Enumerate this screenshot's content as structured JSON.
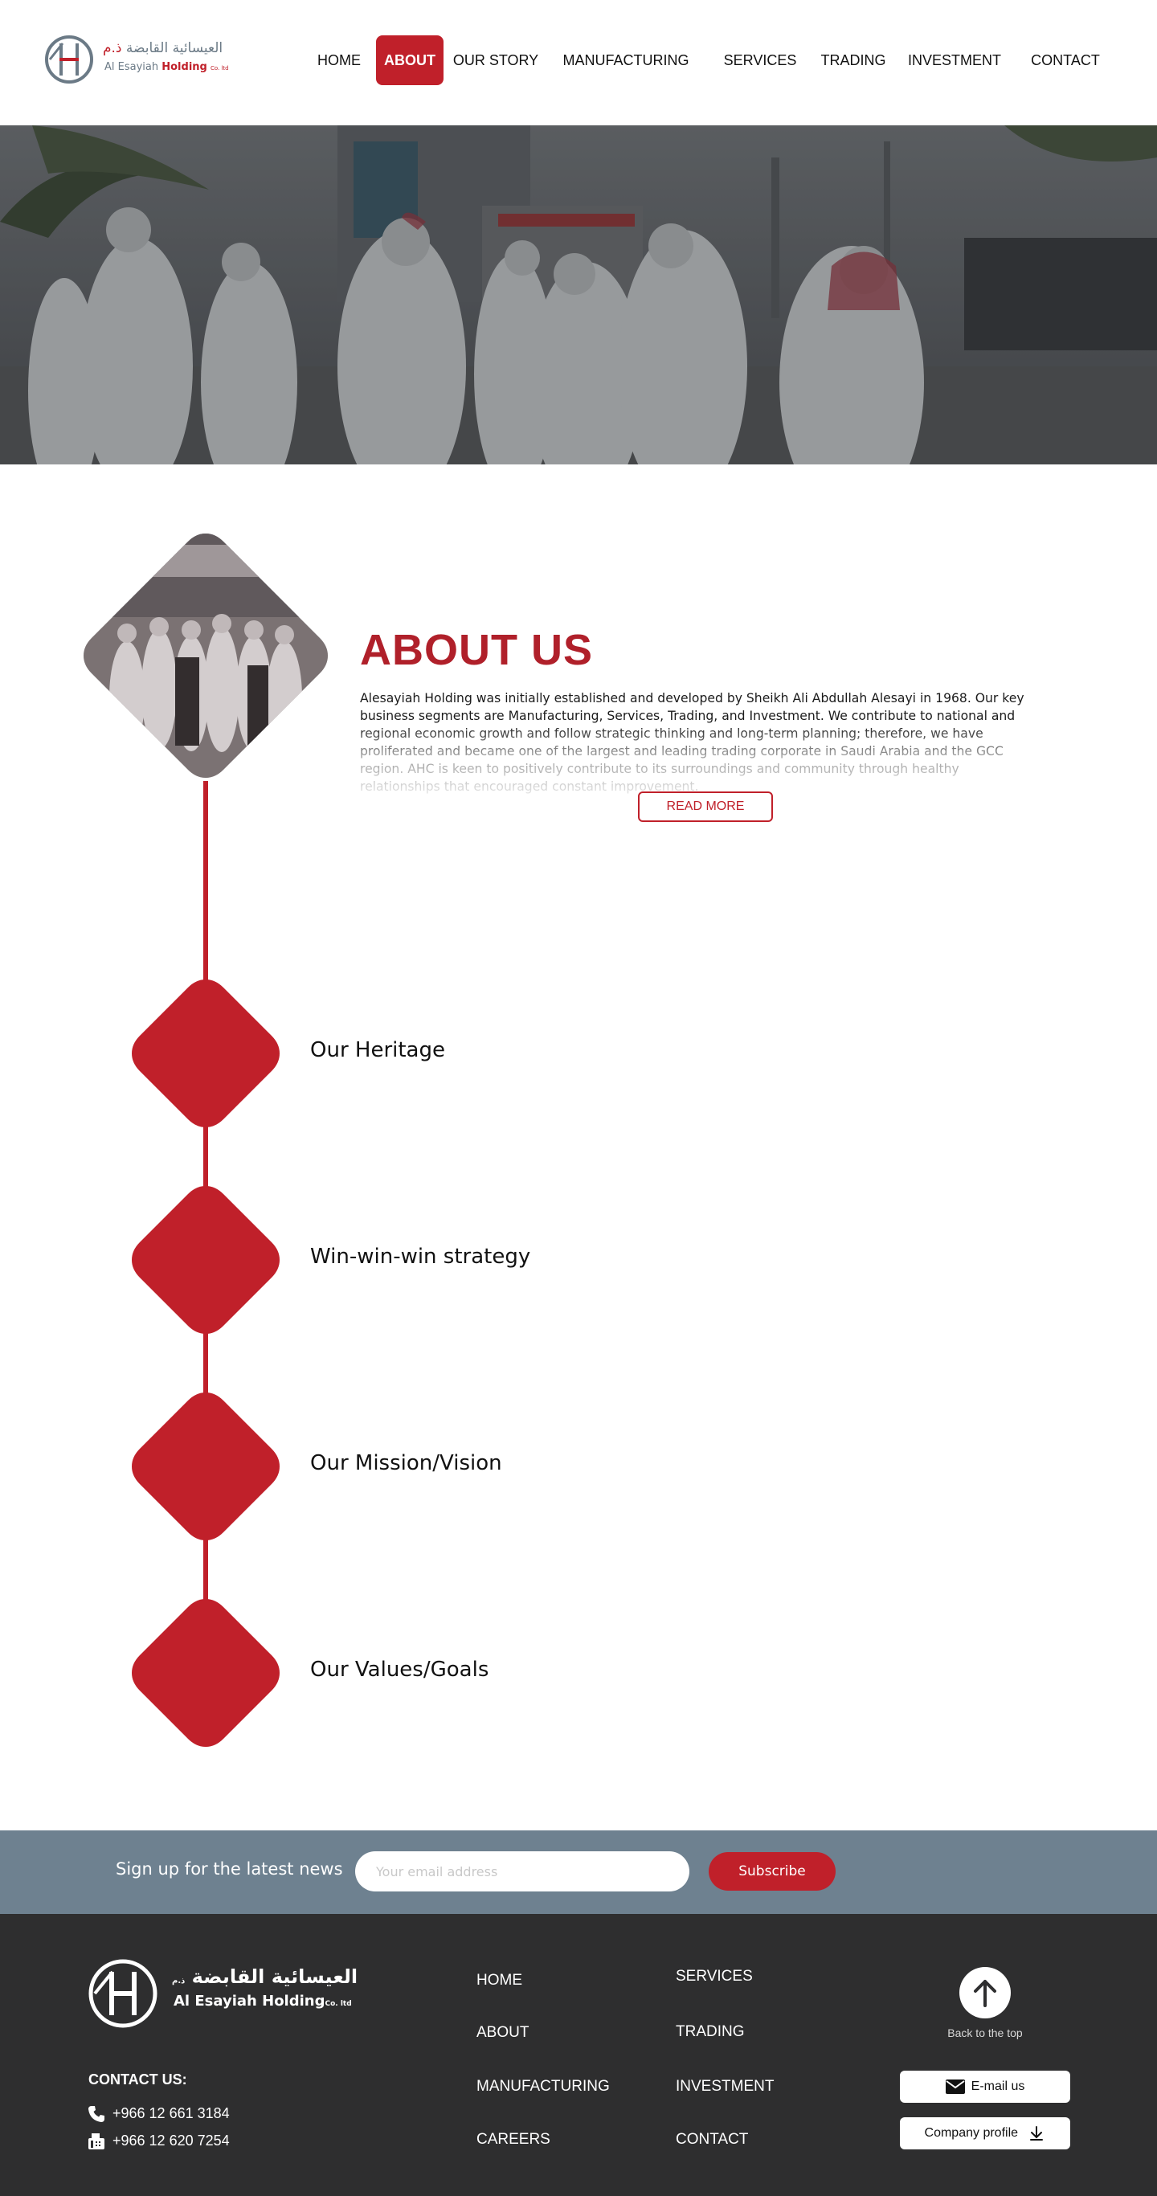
{
  "brand": {
    "name_ar": "العيسائية القابضة",
    "name_ar_suffix": "ذ.م",
    "name_en_prefix": "Al Esayiah",
    "name_en_highlight": "Holding",
    "name_en_suffix": "Co. ltd",
    "accent": "#c0202a",
    "steel": "#6b7a86"
  },
  "nav": {
    "items": [
      {
        "label": "HOME",
        "active": false
      },
      {
        "label": "ABOUT",
        "active": true
      },
      {
        "label": "OUR STORY",
        "active": false
      },
      {
        "label": "MANUFACTURING",
        "active": false
      },
      {
        "label": "SERVICES",
        "active": false
      },
      {
        "label": "TRADING",
        "active": false
      },
      {
        "label": "INVESTMENT",
        "active": false
      },
      {
        "label": "CONTACT",
        "active": false
      }
    ]
  },
  "about": {
    "title": "ABOUT US",
    "body": "Alesayiah Holding was initially established and developed by Sheikh Ali Abdullah Alesayi in 1968. Our key business segments are Manufacturing, Services, Trading, and Investment. We contribute to national and regional economic growth and follow strategic thinking and long-term planning; therefore, we have proliferated and became one of the largest and leading trading corporate in Saudi Arabia and the GCC region. AHC is keen to positively contribute to its surroundings and community through healthy relationships that encouraged constant improvement.",
    "read_more": "READ MORE"
  },
  "timeline": {
    "items": [
      {
        "label": "Our Heritage"
      },
      {
        "label": "Win-win-win strategy"
      },
      {
        "label": "Our Mission/Vision"
      },
      {
        "label": "Our Values/Goals"
      }
    ]
  },
  "newsletter": {
    "label": "Sign up for the latest news",
    "placeholder": "Your email address",
    "button": "Subscribe"
  },
  "footer": {
    "contact_title": "CONTACT US:",
    "phone": "+966 12 661 3184",
    "fax": "+966 12 620 7254",
    "links_col1": [
      "HOME",
      "ABOUT",
      "MANUFACTURING",
      "CAREERS"
    ],
    "links_col2": [
      "SERVICES",
      "TRADING",
      "INVESTMENT",
      "CONTACT"
    ],
    "back_to_top": "Back to the top",
    "email_button": "E-mail us",
    "profile_button": "Company profile"
  }
}
